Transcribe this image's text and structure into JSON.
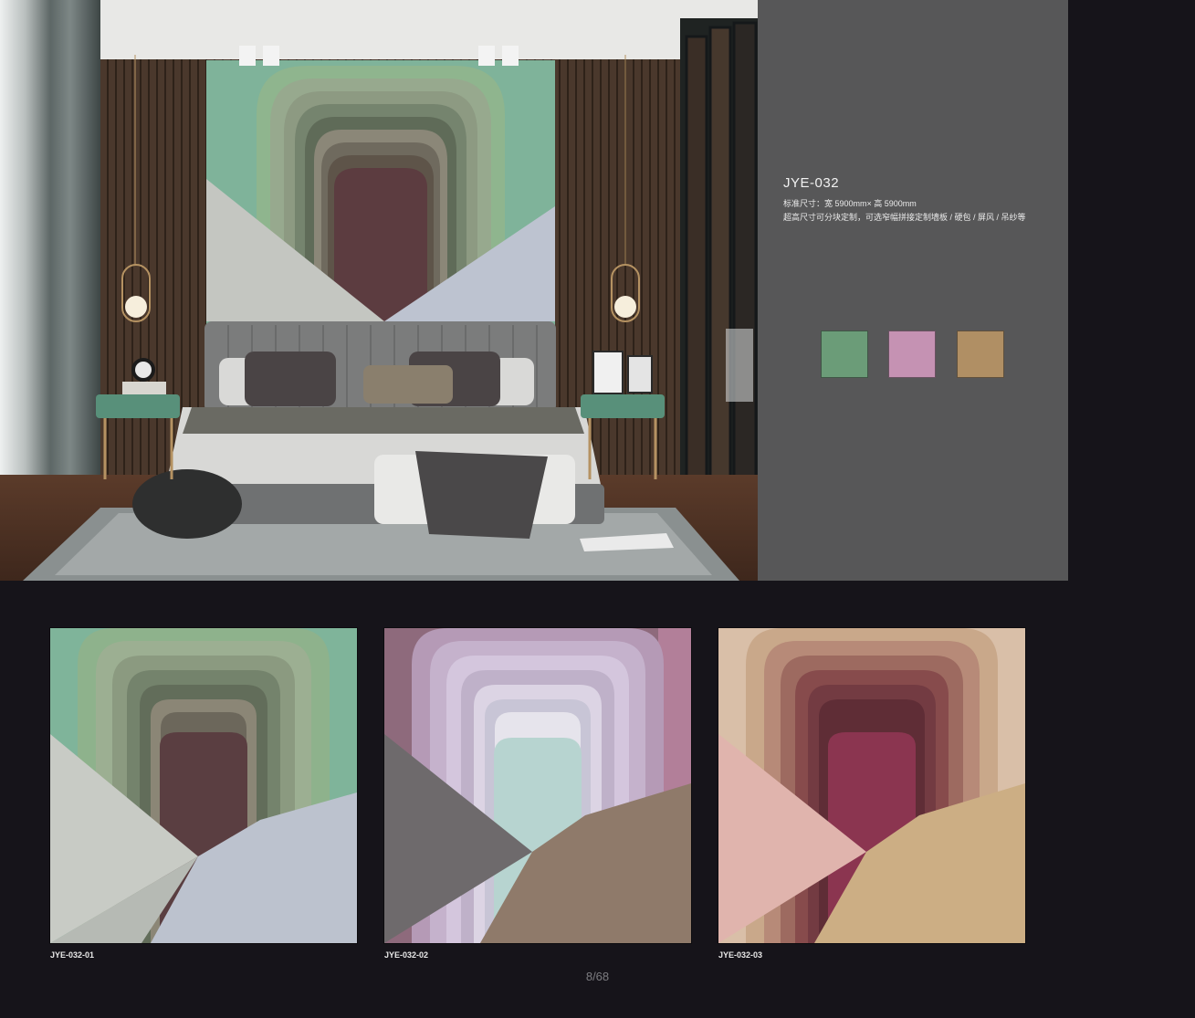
{
  "product": {
    "code": "JYE-032",
    "spec_line1": "标准尺寸：宽 5900mm× 高 5900mm",
    "spec_line2": "超高尺寸可分块定制，可选窄幅拼接定制墙板 / 硬包 / 屏风 / 吊纱等"
  },
  "swatches": [
    {
      "name": "green",
      "color": "#6b9c78"
    },
    {
      "name": "pink",
      "color": "#c592b3"
    },
    {
      "name": "tan",
      "color": "#b08f64"
    }
  ],
  "variants": [
    {
      "label": "JYE-032-01"
    },
    {
      "label": "JYE-032-02"
    },
    {
      "label": "JYE-032-03"
    }
  ],
  "page": {
    "indicator": "8/68"
  }
}
